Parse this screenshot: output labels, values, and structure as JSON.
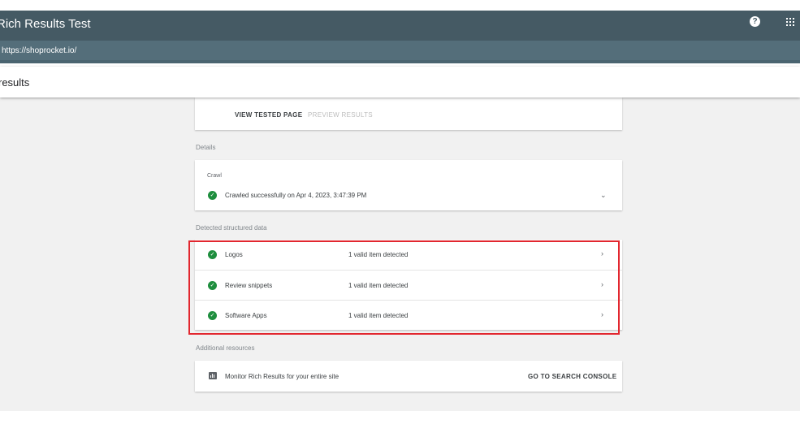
{
  "app": {
    "title": "Rich Results Test"
  },
  "header": {
    "help_icon": "help-circle-icon",
    "apps_icon": "apps-grid-icon"
  },
  "url_bar": {
    "url": "https://shoprocket.io/"
  },
  "results_bar": {
    "title": "results"
  },
  "tabs": [
    {
      "label": "VIEW TESTED PAGE",
      "active": true
    },
    {
      "label": "PREVIEW RESULTS",
      "active": false
    }
  ],
  "details": {
    "section_label": "Details",
    "crawl": {
      "label": "Crawl",
      "status": "Crawled successfully on Apr 4, 2023, 3:47:39 PM",
      "status_icon": "check-circle-icon",
      "expand_icon": "chevron-down-icon"
    }
  },
  "structured_data": {
    "section_label": "Detected structured data",
    "items": [
      {
        "name": "Logos",
        "status": "1 valid item detected"
      },
      {
        "name": "Review snippets",
        "status": "1 valid item detected"
      },
      {
        "name": "Software Apps",
        "status": "1 valid item detected"
      }
    ]
  },
  "additional_resources": {
    "section_label": "Additional resources",
    "monitor_text": "Monitor Rich Results for your entire site",
    "link_label": "GO TO SEARCH CONSOLE",
    "icon": "bar-chart-icon"
  },
  "colors": {
    "topbar": "#455a64",
    "urlbar": "#546e7a",
    "success_green": "#1e8e3e",
    "highlight_red": "#e2272f",
    "background": "#f1f1f1"
  }
}
